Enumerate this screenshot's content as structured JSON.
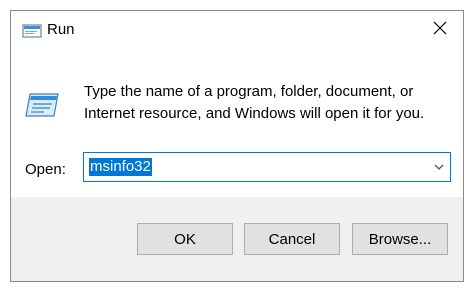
{
  "window": {
    "title": "Run",
    "title_icon": "run-icon",
    "close_icon": "close-icon"
  },
  "content": {
    "icon": "run-dialog-icon",
    "description_line1": "Type the name of a program, folder, document, or",
    "description_line2": "Internet resource, and Windows will open it for you.",
    "open_label": "Open:",
    "open_value": "msinfo32",
    "dropdown_icon": "chevron-down-icon"
  },
  "buttons": {
    "ok": "OK",
    "cancel": "Cancel",
    "browse": "Browse..."
  },
  "colors": {
    "accent": "#0078d7",
    "footer_bg": "#f0f0f0",
    "button_bg": "#e1e1e1"
  }
}
